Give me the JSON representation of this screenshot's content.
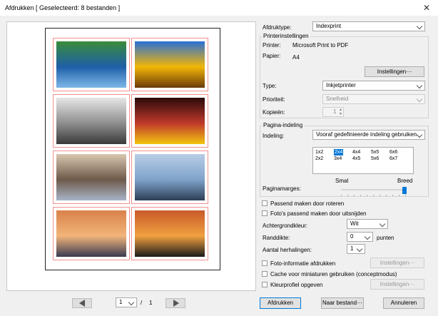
{
  "window": {
    "title": "Afdrukken [ Geselecteerd: 8 bestanden ]",
    "close_glyph": "✕"
  },
  "preview": {
    "page_current": "1",
    "page_separator": "/",
    "page_total": "1",
    "thumbnails": [
      {
        "name": "forest-lake",
        "colors": [
          "#3a8c3a",
          "#1e5fa8",
          "#7fb8e8"
        ]
      },
      {
        "name": "sunflower",
        "colors": [
          "#2a6fd6",
          "#f2b705",
          "#6b3a0a"
        ]
      },
      {
        "name": "monochrome-lake",
        "colors": [
          "#e6e6e6",
          "#8e8e8e",
          "#3a3a3a"
        ]
      },
      {
        "name": "night-street",
        "colors": [
          "#2a0a0a",
          "#c0392b",
          "#f1c40f"
        ]
      },
      {
        "name": "motion-people",
        "colors": [
          "#d9c7b0",
          "#6e5a4a",
          "#a8b4c8"
        ]
      },
      {
        "name": "harbor",
        "colors": [
          "#b9cde6",
          "#7fa3cc",
          "#2d3e55"
        ]
      },
      {
        "name": "sunset-sea",
        "colors": [
          "#d9824a",
          "#f2b57a",
          "#3a3a52"
        ]
      },
      {
        "name": "sunset-trees",
        "colors": [
          "#c85a2a",
          "#f0a040",
          "#1a1a1a"
        ]
      }
    ]
  },
  "print_type": {
    "label": "Afdruktype:",
    "value": "Indexprint"
  },
  "printer_settings": {
    "legend": "Printerinstellingen",
    "printer_label": "Printer:",
    "printer_value": "Microsoft Print to PDF",
    "paper_label": "Papier:",
    "paper_value": "A4",
    "settings_button": "Instellingen···",
    "type_label": "Type:",
    "type_value": "Inkjetprinter",
    "priority_label": "Prioriteit:",
    "priority_value": "Snelheid",
    "copies_label": "Kopieën:",
    "copies_value": "1"
  },
  "page_layout": {
    "legend": "Pagina-indeling",
    "layout_label": "Indeling:",
    "layout_value": "Vooraf gedefinieerde indeling gebruiken",
    "grid": [
      [
        "1x2",
        "2x4",
        "4x4",
        "5x5",
        "6x6"
      ],
      [
        "2x2",
        "3x4",
        "4x5",
        "5x6",
        "6x7"
      ]
    ],
    "grid_selected": "2x4",
    "margin_label": "Paginamarges:",
    "margin_small": "Smal",
    "margin_wide": "Breed",
    "margin_level": 1.0
  },
  "options": {
    "rotate_fit": "Passend maken door roteren",
    "crop_fit": "Foto's passend maken door uitsnijden",
    "bg_label": "Achtergrondkleur:",
    "bg_value": "Wit",
    "border_label": "Randdikte:",
    "border_value": "0",
    "border_unit": "punten",
    "repeat_label": "Aantal herhalingen:",
    "repeat_value": "1",
    "photo_info": "Foto-informatie afdrukken",
    "photo_info_settings": "Instellingen···",
    "cache": "Cache voor miniaturen gebruiken (conceptmodus)",
    "color_profile": "Kleurprofiel opgeven",
    "color_profile_settings": "Instellingen···"
  },
  "footer": {
    "print_button": "Afdrukken",
    "to_file_button": "Naar bestand···",
    "cancel_button": "Annuleren"
  }
}
